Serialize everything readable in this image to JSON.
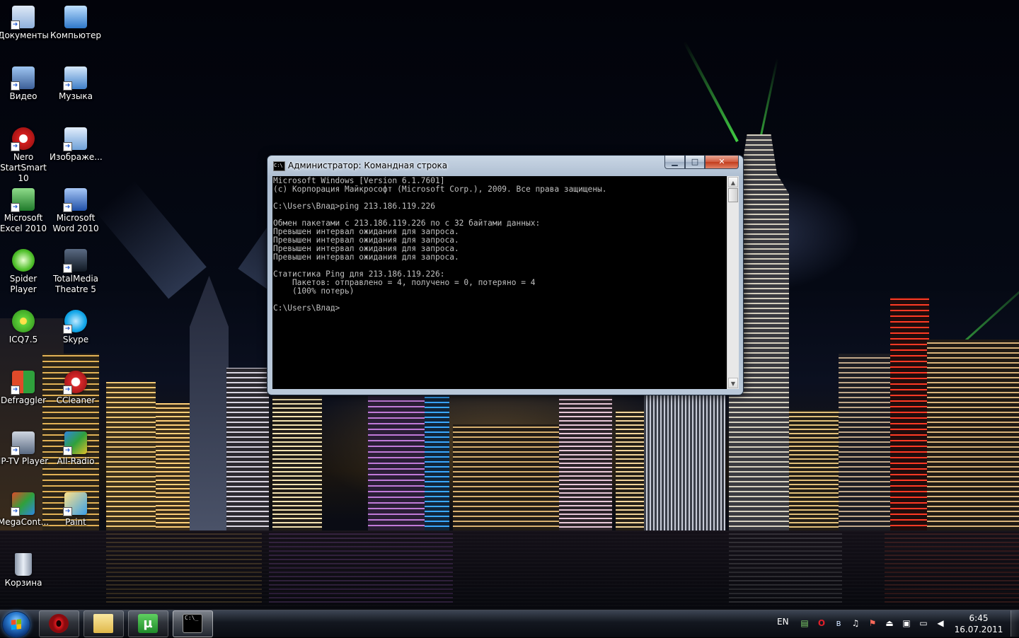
{
  "desktop": {
    "icons": [
      {
        "label": "Документы",
        "icon": "documents-icon"
      },
      {
        "label": "Компьютер",
        "icon": "computer-icon"
      },
      {
        "label": "Видео",
        "icon": "video-icon"
      },
      {
        "label": "Музыка",
        "icon": "music-icon"
      },
      {
        "label": "Nero\nStartSmart 10",
        "icon": "nero-icon"
      },
      {
        "label": "Изображе...",
        "icon": "pictures-icon"
      },
      {
        "label": "Microsoft\nExcel 2010",
        "icon": "excel-icon"
      },
      {
        "label": "Microsoft\nWord 2010",
        "icon": "word-icon"
      },
      {
        "label": "Spider Player",
        "icon": "spider-player-icon"
      },
      {
        "label": "TotalMedia\nTheatre 5",
        "icon": "totalmedia-icon"
      },
      {
        "label": "ICQ7.5",
        "icon": "icq-icon"
      },
      {
        "label": "Skype",
        "icon": "skype-icon"
      },
      {
        "label": "Defraggler",
        "icon": "defraggler-icon"
      },
      {
        "label": "CCleaner",
        "icon": "ccleaner-icon"
      },
      {
        "label": "IP-TV Player",
        "icon": "iptv-player-icon"
      },
      {
        "label": "All-Radio",
        "icon": "all-radio-icon"
      },
      {
        "label": "MegaCont...",
        "icon": "megacontent-icon"
      },
      {
        "label": "Paint",
        "icon": "paint-icon"
      },
      {
        "label": "Корзина",
        "icon": "recycle-bin-icon"
      }
    ]
  },
  "cmd_window": {
    "title": "Администратор: Командная строка",
    "title_icon_text": "C:\\",
    "minimize_glyph": "▁",
    "maximize_glyph": "□",
    "close_glyph": "✕",
    "scroll_up_glyph": "▲",
    "scroll_down_glyph": "▼",
    "output": "Microsoft Windows [Version 6.1.7601]\n(c) Корпорация Майкрософт (Microsoft Corp.), 2009. Все права защищены.\n\nC:\\Users\\Влад>ping 213.186.119.226\n\nОбмен пакетами с 213.186.119.226 по с 32 байтами данных:\nПревышен интервал ожидания для запроса.\nПревышен интервал ожидания для запроса.\nПревышен интервал ожидания для запроса.\nПревышен интервал ожидания для запроса.\n\nСтатистика Ping для 213.186.119.226:\n    Пакетов: отправлено = 4, получено = 0, потеряно = 4\n    (100% потерь)\n\nC:\\Users\\Влад>"
  },
  "taskbar": {
    "pinned": [
      {
        "name": "opera",
        "icon": "opera-icon",
        "glyph": "O",
        "color": "#cc0f16"
      },
      {
        "name": "explorer",
        "icon": "explorer-folder-icon",
        "glyph": "",
        "color": "#e8c45a"
      },
      {
        "name": "utorrent",
        "icon": "utorrent-icon",
        "glyph": "µ",
        "color": "#2f9a3a"
      },
      {
        "name": "cmd",
        "icon": "cmd-icon",
        "glyph": "C:\\_",
        "color": "#000000"
      }
    ],
    "language": "EN",
    "clock": {
      "time": "6:45",
      "date": "16.07.2011"
    },
    "tray_icons": [
      "network-icon",
      "opera-tray-icon",
      "bluetooth-icon",
      "notes-icon",
      "flag-icon",
      "safely-remove-icon",
      "device-icon",
      "display-icon",
      "volume-icon"
    ]
  },
  "colors": {
    "console_bg": "#000000",
    "console_text": "#c0c0c0",
    "close_button": "#c23b1c"
  }
}
